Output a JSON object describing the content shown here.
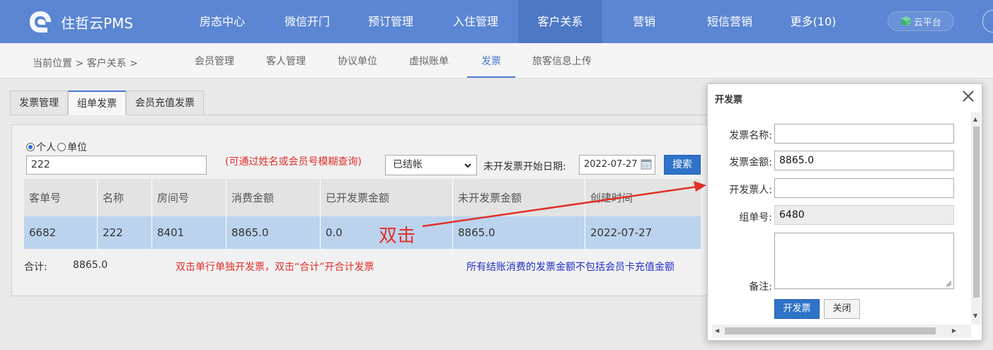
{
  "nav": {
    "brand": "住哲云PMS",
    "items": [
      {
        "label": "房态中心"
      },
      {
        "label": "微信开门"
      },
      {
        "label": "预订管理"
      },
      {
        "label": "入住管理"
      },
      {
        "label": "客户关系"
      },
      {
        "label": "营销"
      },
      {
        "label": "短信营销"
      },
      {
        "label": "更多(10)"
      }
    ],
    "active_index": 4,
    "cloud_button": "云平台"
  },
  "breadcrumb": "当前位置 > 客户关系 >",
  "subnav": [
    "会员管理",
    "客人管理",
    "协议单位",
    "虚拟账单",
    "发票",
    "旅客信息上传"
  ],
  "subnav_active": "发票",
  "page_tabs": [
    "发票管理",
    "组单发票",
    "会员充值发票"
  ],
  "page_tab_active": "组单发票",
  "filters": {
    "radio_personal": "个人",
    "radio_unit": "单位",
    "search_value": "222",
    "hint": "(可通过姓名或会员号模糊查询)",
    "status_value": "已结帐",
    "date_label": "未开发票开始日期:",
    "date_value": "2022-07-27",
    "search_button": "搜索"
  },
  "table": {
    "headers": [
      "客单号",
      "名称",
      "房间号",
      "消费金额",
      "已开发票金额",
      "未开发票金额",
      "创建时间"
    ],
    "rows": [
      [
        "6682",
        "222",
        "8401",
        "8865.0",
        "0.0",
        "8865.0",
        "2022-07-27"
      ]
    ]
  },
  "totals": {
    "label": "合计:",
    "value": "8865.0"
  },
  "notes": {
    "red": "双击单行单独开发票，双击“合计”开合计发票",
    "blue": "所有结账消费的发票金额不包括会员卡充值金额"
  },
  "annotation": "双击",
  "dialog": {
    "title": "开发票",
    "fields": {
      "invoice_name_label": "发票名称:",
      "invoice_name_value": "",
      "amount_label": "发票金额:",
      "amount_value": "8865.0",
      "issuer_label": "开发票人:",
      "issuer_value": "",
      "group_no_label": "组单号:",
      "group_no_value": "6480",
      "remark_label": "备注:"
    },
    "submit_button": "开发票",
    "close_button": "关闭"
  },
  "colors": {
    "nav_bg": "#5b86d3",
    "accent": "#4a79cf",
    "selected_row": "#bcd3ee",
    "primary_button": "#2f73c9",
    "note_red": "#e0302a",
    "note_blue": "#2530c9"
  }
}
